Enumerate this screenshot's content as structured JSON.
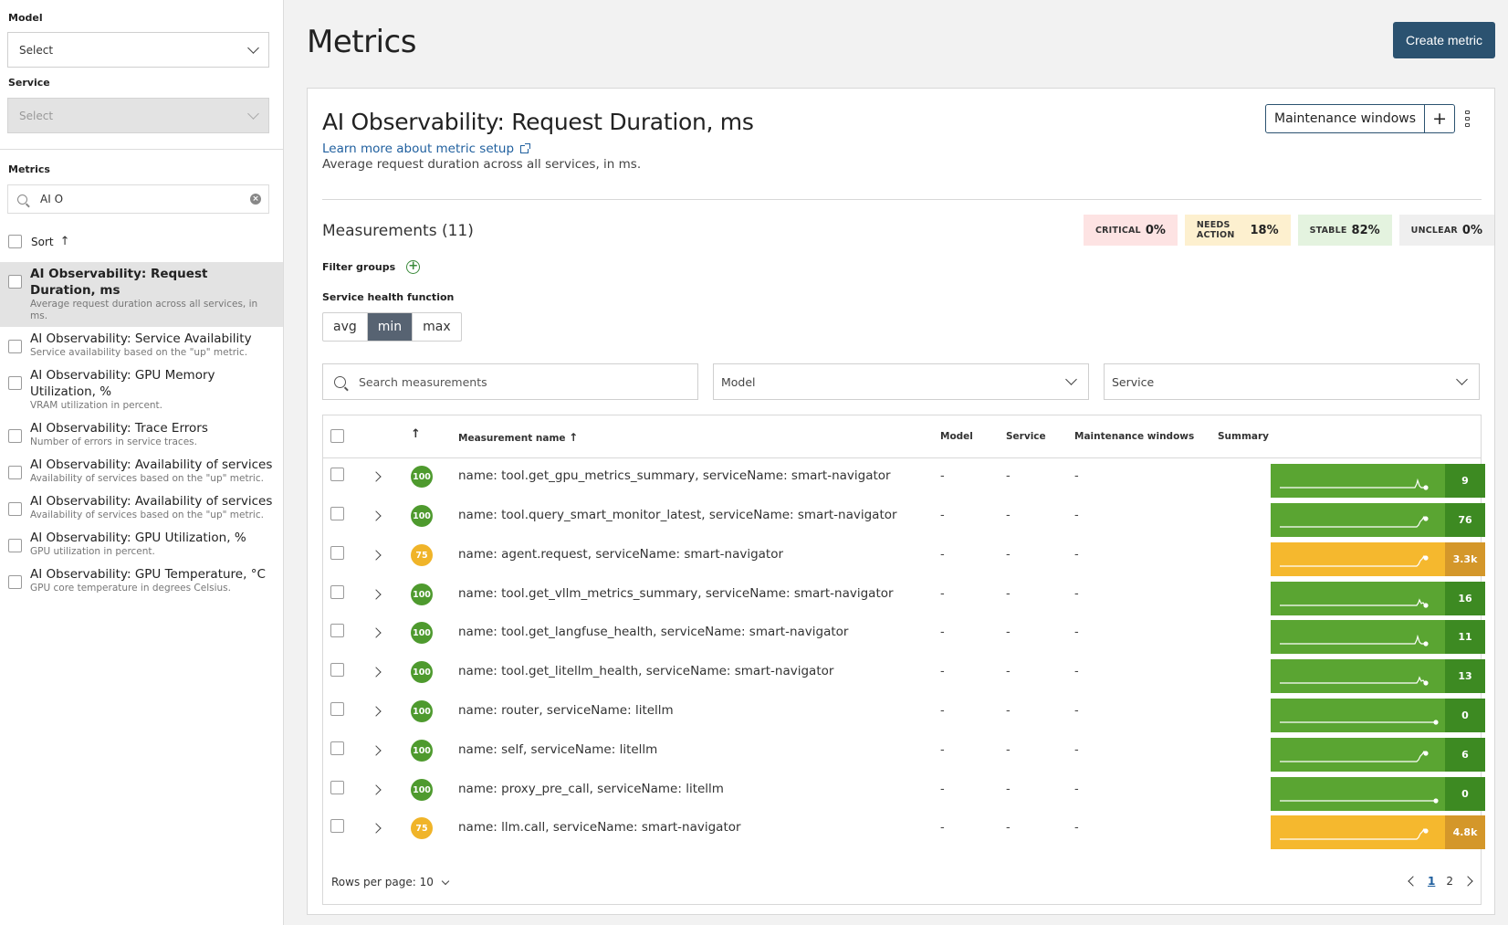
{
  "sidebar": {
    "model_label": "Model",
    "model_value": "Select",
    "service_label": "Service",
    "service_value": "Select",
    "metrics_label": "Metrics",
    "search_value": "AI O",
    "sort_label": "Sort",
    "items": [
      {
        "title": "AI Observability: Request Duration, ms",
        "desc": "Average request duration across all services, in ms."
      },
      {
        "title": "AI Observability: Service Availability",
        "desc": "Service availability based on the \"up\" metric."
      },
      {
        "title": "AI Observability: GPU Memory Utilization, %",
        "desc": "VRAM utilization in percent."
      },
      {
        "title": "AI Observability: Trace Errors",
        "desc": "Number of errors in service traces."
      },
      {
        "title": "AI Observability: Availability of services",
        "desc": "Availability of services based on the \"up\" metric."
      },
      {
        "title": "AI Observability: Availability of services",
        "desc": "Availability of services based on the \"up\" metric."
      },
      {
        "title": "AI Observability: GPU Utilization, %",
        "desc": "GPU utilization in percent."
      },
      {
        "title": "AI Observability: GPU Temperature, °C",
        "desc": "GPU core temperature in degrees Celsius."
      }
    ]
  },
  "header": {
    "title": "Metrics",
    "create_button": "Create metric"
  },
  "card": {
    "title": "AI Observability: Request Duration, ms",
    "learn_link": "Learn more about metric setup",
    "description": "Average request duration across all services, in ms.",
    "maintenance_button": "Maintenance windows",
    "plus": "+",
    "measurements_title": "Measurements (11)",
    "stats": [
      {
        "label": "CRITICAL",
        "value": "0%",
        "color": "#fde3e3"
      },
      {
        "label": "NEEDS ACTION",
        "value": "18%",
        "color": "#fdf0cf"
      },
      {
        "label": "STABLE",
        "value": "82%",
        "color": "#e4f3df"
      },
      {
        "label": "UNCLEAR",
        "value": "0%",
        "color": "#efefef"
      }
    ],
    "filter_groups_label": "Filter groups",
    "health_function_label": "Service health function",
    "health_options": [
      "avg",
      "min",
      "max"
    ],
    "health_selected": "min",
    "search_placeholder": "Search measurements",
    "model_filter": "Model",
    "service_filter": "Service"
  },
  "table": {
    "headers": {
      "name": "Measurement name",
      "model": "Model",
      "service": "Service",
      "maintenance": "Maintenance windows",
      "summary": "Summary"
    },
    "rows": [
      {
        "score": "100",
        "status": "green",
        "name": "name: tool.get_gpu_metrics_summary, serviceName: smart-navigator",
        "model": "-",
        "service": "-",
        "maintenance": "-",
        "value": "9",
        "spark": "m2"
      },
      {
        "score": "100",
        "status": "green",
        "name": "name: tool.query_smart_monitor_latest, serviceName: smart-navigator",
        "model": "-",
        "service": "-",
        "maintenance": "-",
        "value": "76",
        "spark": "rise"
      },
      {
        "score": "75",
        "status": "yellow",
        "name": "name: agent.request, serviceName: smart-navigator",
        "model": "-",
        "service": "-",
        "maintenance": "-",
        "value": "3.3k",
        "spark": "rise"
      },
      {
        "score": "100",
        "status": "green",
        "name": "name: tool.get_vllm_metrics_summary, serviceName: smart-navigator",
        "model": "-",
        "service": "-",
        "maintenance": "-",
        "value": "16",
        "spark": "m1"
      },
      {
        "score": "100",
        "status": "green",
        "name": "name: tool.get_langfuse_health, serviceName: smart-navigator",
        "model": "-",
        "service": "-",
        "maintenance": "-",
        "value": "11",
        "spark": "m2"
      },
      {
        "score": "100",
        "status": "green",
        "name": "name: tool.get_litellm_health, serviceName: smart-navigator",
        "model": "-",
        "service": "-",
        "maintenance": "-",
        "value": "13",
        "spark": "m1"
      },
      {
        "score": "100",
        "status": "green",
        "name": "name: router, serviceName: litellm",
        "model": "-",
        "service": "-",
        "maintenance": "-",
        "value": "0",
        "spark": "flat"
      },
      {
        "score": "100",
        "status": "green",
        "name": "name: self, serviceName: litellm",
        "model": "-",
        "service": "-",
        "maintenance": "-",
        "value": "6",
        "spark": "rise"
      },
      {
        "score": "100",
        "status": "green",
        "name": "name: proxy_pre_call, serviceName: litellm",
        "model": "-",
        "service": "-",
        "maintenance": "-",
        "value": "0",
        "spark": "flat"
      },
      {
        "score": "75",
        "status": "yellow",
        "name": "name: llm.call, serviceName: smart-navigator",
        "model": "-",
        "service": "-",
        "maintenance": "-",
        "value": "4.8k",
        "spark": "rise"
      }
    ],
    "rows_per_page": "Rows per page: 10",
    "pages": [
      "1",
      "2"
    ],
    "current_page": "1"
  }
}
